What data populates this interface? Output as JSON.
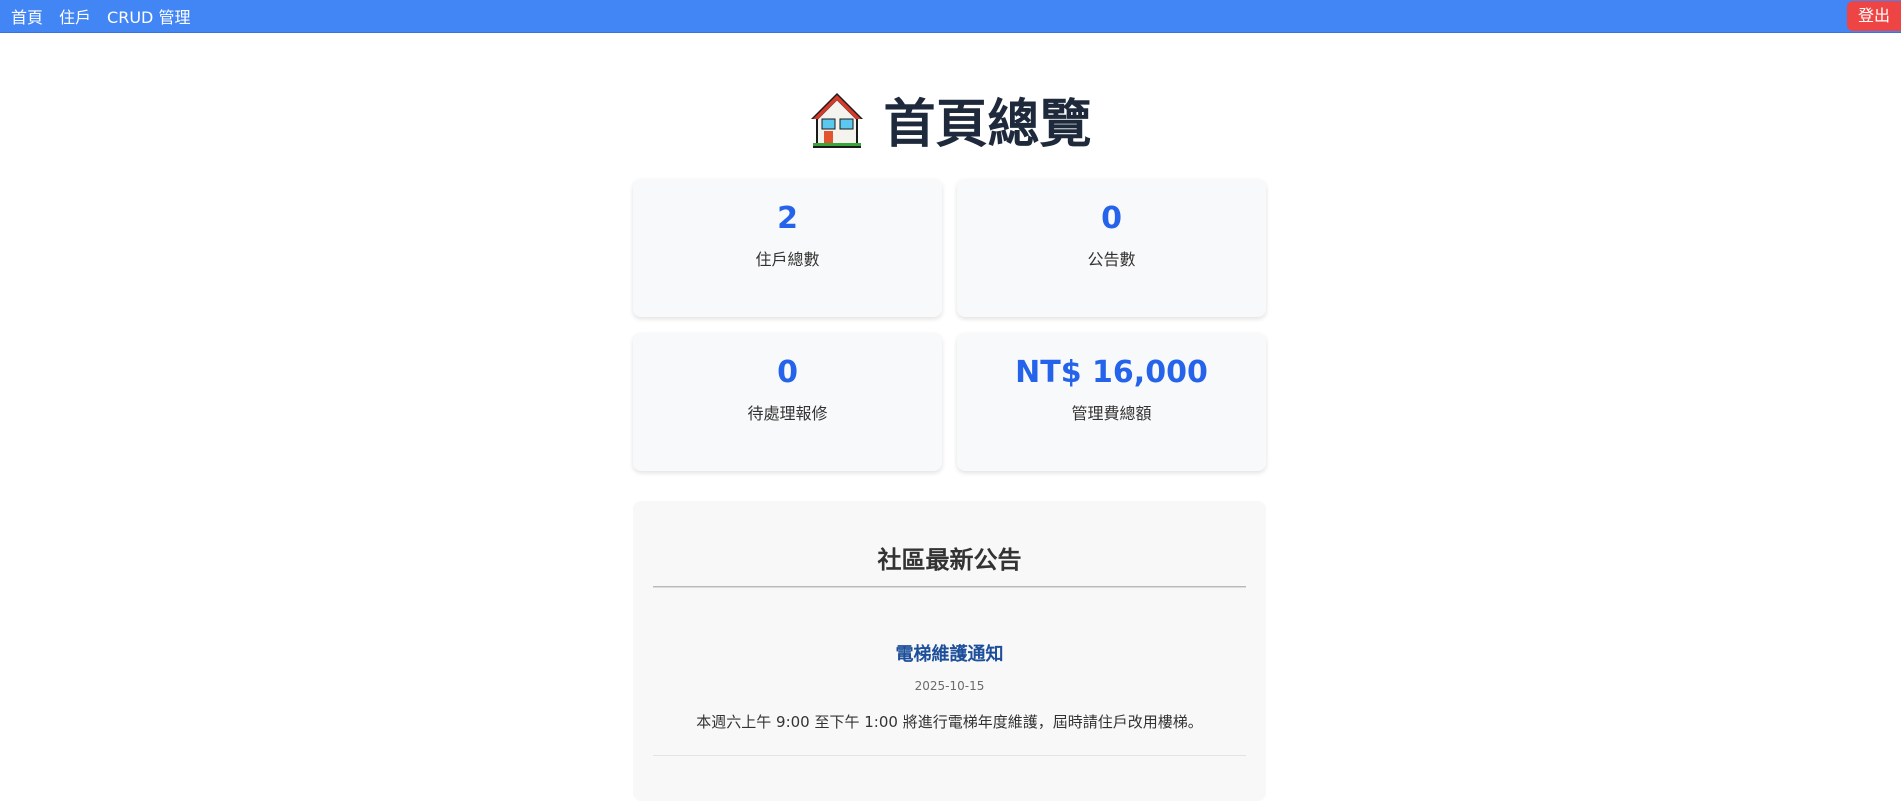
{
  "nav": {
    "items": [
      {
        "label": "首頁"
      },
      {
        "label": "住戶"
      },
      {
        "label": "CRUD 管理"
      }
    ],
    "logout_label": "登出"
  },
  "page": {
    "title": "首頁總覽",
    "icon": "house-icon"
  },
  "stats": [
    {
      "value": "2",
      "label": "住戶總數"
    },
    {
      "value": "0",
      "label": "公告數"
    },
    {
      "value": "0",
      "label": "待處理報修"
    },
    {
      "value": "NT$ 16,000",
      "label": "管理費總額"
    }
  ],
  "announcements": {
    "title": "社區最新公告",
    "posts": [
      {
        "title": "電梯維護通知",
        "date": "2025-10-15",
        "content": "本週六上午 9:00 至下午 1:00 將進行電梯年度維護，屆時請住戶改用樓梯。"
      }
    ]
  },
  "colors": {
    "topbar": "#4285f4",
    "logout": "#ef4444",
    "stat_value": "#2563eb",
    "post_title": "#1d4f9a"
  }
}
